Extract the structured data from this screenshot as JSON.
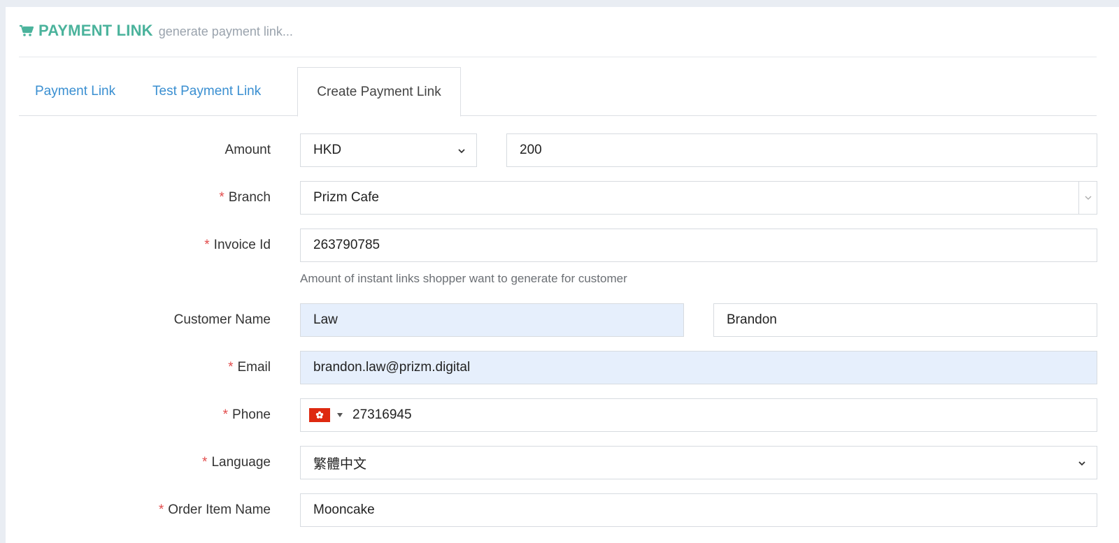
{
  "header": {
    "icon": "cart-icon",
    "title": "PAYMENT LINK",
    "subtitle": "generate payment link...",
    "accent_color": "#4bb39c"
  },
  "tabs": [
    {
      "label": "Payment Link",
      "active": false
    },
    {
      "label": "Test Payment Link",
      "active": false
    },
    {
      "label": "Create Payment Link",
      "active": true
    }
  ],
  "form": {
    "amount": {
      "label": "Amount",
      "currency": "HKD",
      "value": "200"
    },
    "branch": {
      "label": "Branch",
      "required_mark": "*",
      "value": "Prizm Cafe"
    },
    "invoice_id": {
      "label": "Invoice Id",
      "required_mark": "*",
      "value": "263790785",
      "help": "Amount of instant links shopper want to generate for customer"
    },
    "customer_name": {
      "label": "Customer Name",
      "last_name": "Law",
      "first_name": "Brandon"
    },
    "email": {
      "label": "Email",
      "required_mark": "*",
      "value": "brandon.law@prizm.digital"
    },
    "phone": {
      "label": "Phone",
      "required_mark": "*",
      "country_flag": "hong-kong-flag-icon",
      "value": "27316945"
    },
    "language": {
      "label": "Language",
      "required_mark": "*",
      "value": "繁體中文"
    },
    "order_item_name": {
      "label": "Order Item Name",
      "required_mark": "*",
      "value": "Mooncake"
    }
  }
}
